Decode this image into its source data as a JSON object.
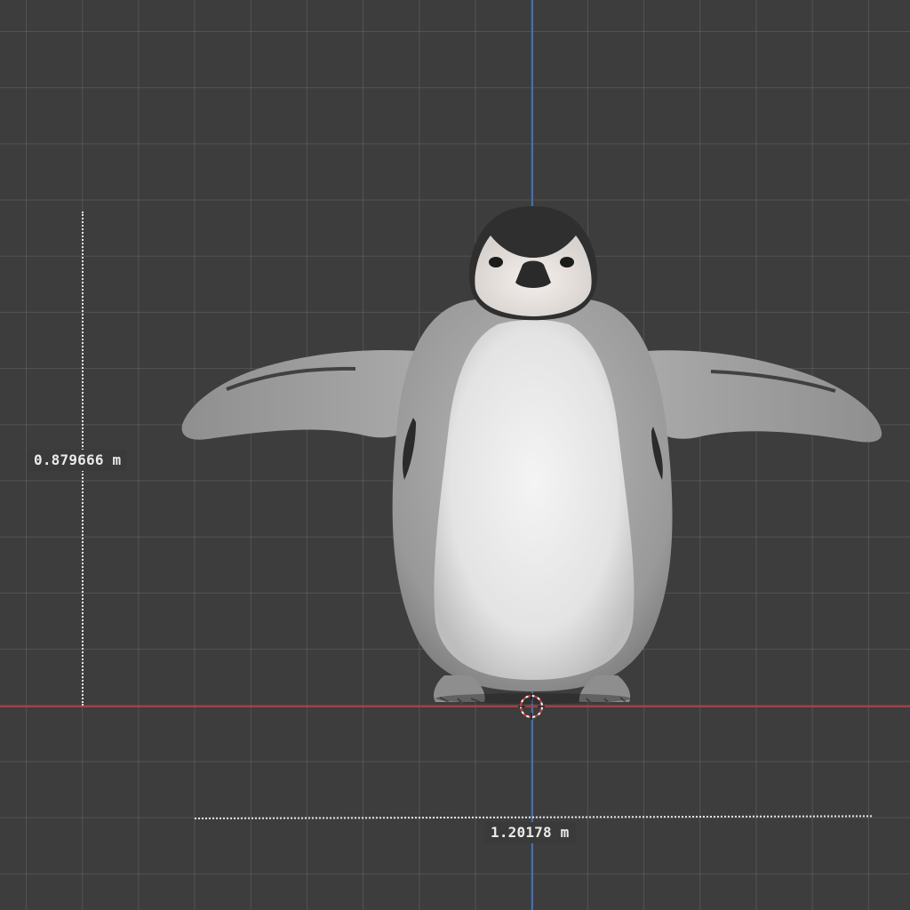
{
  "viewport": {
    "background_color": "#3d3d3d",
    "grid_color": "#4f4f4f",
    "x_axis_color": "#b23a3f",
    "y_axis_color": "#3d73b8"
  },
  "measurements": {
    "height_label": "0.879666 m",
    "width_label": "1.20178 m"
  },
  "model": {
    "icon": "penguin-model"
  },
  "cursor": {
    "icon": "3d-cursor-icon"
  }
}
